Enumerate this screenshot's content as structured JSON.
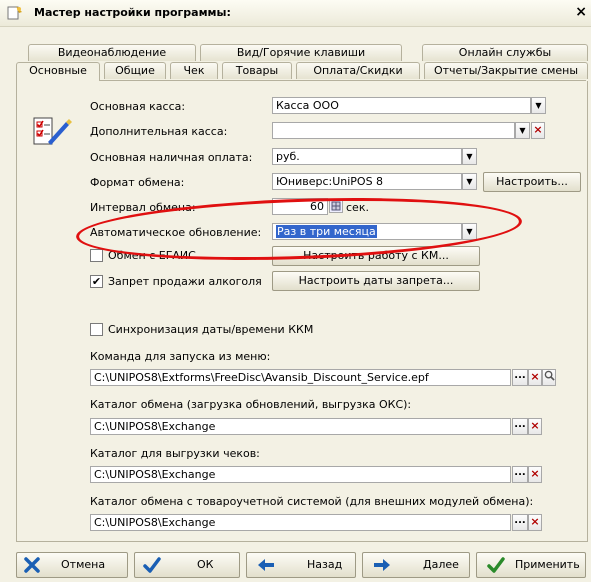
{
  "window": {
    "title": "Мастер настройки программы:",
    "close": "×"
  },
  "tabs_row1": [
    "Видеонаблюдение",
    "Вид/Горячие клавиши",
    "Онлайн службы"
  ],
  "tabs_row2": [
    "Основные",
    "Общие",
    "Чек",
    "Товары",
    "Оплата/Скидки",
    "Отчеты/Закрытие смены"
  ],
  "form": {
    "main_kassa_label": "Основная касса:",
    "main_kassa_value": "Касса ООО",
    "extra_kassa_label": "Дополнительная касса:",
    "extra_kassa_value": "",
    "cash_payment_label": "Основная наличная оплата:",
    "cash_payment_value": "руб.",
    "exchange_format_label": "Формат обмена:",
    "exchange_format_value": "Юниверс:UniPOS 8",
    "configure_button": "Настроить...",
    "interval_label": "Интервал обмена:",
    "interval_value": "60",
    "interval_unit": "сек.",
    "auto_update_label": "Автоматическое обновление:",
    "auto_update_value": "Раз в три месяца",
    "egais_label": "Обмен с ЕГАИС",
    "egais_checked": false,
    "configure_kkm_button": "Настроить работу с КМ...",
    "alcohol_label": "Запрет продажи алкоголя",
    "alcohol_checked": true,
    "configure_dates_button": "Настроить даты запрета...",
    "sync_label": "Синхронизация даты/времени ККМ",
    "sync_checked": false,
    "menu_command_label": "Команда для запуска из меню:",
    "menu_command_value": "C:\\UNIPOS8\\Extforms\\FreeDisc\\Avansib_Discount_Service.epf",
    "exchange_dir_label": "Каталог обмена (загрузка обновлений, выгрузка ОКС):",
    "exchange_dir_value": "C:\\UNIPOS8\\Exchange",
    "receipts_dir_label": "Каталог для выгрузки чеков:",
    "receipts_dir_value": "C:\\UNIPOS8\\Exchange",
    "accounting_dir_label": "Каталог обмена с товароучетной системой (для внешних модулей обмена):",
    "accounting_dir_value": "C:\\UNIPOS8\\Exchange"
  },
  "buttons": {
    "cancel": "Отмена",
    "ok": "ОК",
    "back": "Назад",
    "next": "Далее",
    "apply": "Применить"
  },
  "colors": {
    "highlight_ellipse": "#e01010",
    "selection": "#3366cc",
    "cancel_icon": "#1a5fb4",
    "ok_icon": "#1a5fb4",
    "apply_icon": "#2a8a2a"
  }
}
